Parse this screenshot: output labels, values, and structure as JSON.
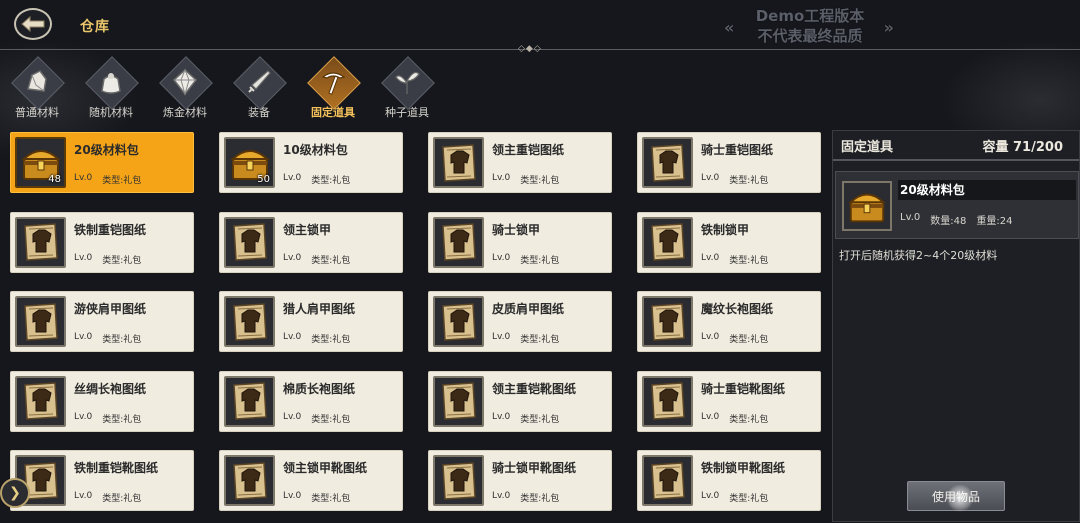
{
  "header": {
    "title": "仓库",
    "watermark_line1": "Demo工程版本",
    "watermark_line2": "不代表最终品质"
  },
  "tabs": [
    {
      "label": "普通材料",
      "icon": "ore-icon",
      "active": false
    },
    {
      "label": "随机材料",
      "icon": "bag-icon",
      "active": false
    },
    {
      "label": "炼金材料",
      "icon": "crystal-icon",
      "active": false
    },
    {
      "label": "装备",
      "icon": "sword-icon",
      "active": false
    },
    {
      "label": "固定道具",
      "icon": "pickaxe-icon",
      "active": true
    },
    {
      "label": "种子道具",
      "icon": "sprout-icon",
      "active": false
    }
  ],
  "items": [
    {
      "name": "20级材料包",
      "level": "Lv.0",
      "type": "类型:礼包",
      "qty": "48",
      "icon": "chest-icon",
      "selected": true
    },
    {
      "name": "10级材料包",
      "level": "Lv.0",
      "type": "类型:礼包",
      "qty": "50",
      "icon": "chest-icon",
      "selected": false
    },
    {
      "name": "领主重铠图纸",
      "level": "Lv.0",
      "type": "类型:礼包",
      "qty": "",
      "icon": "blueprint-icon",
      "selected": false
    },
    {
      "name": "骑士重铠图纸",
      "level": "Lv.0",
      "type": "类型:礼包",
      "qty": "",
      "icon": "blueprint-icon",
      "selected": false
    },
    {
      "name": "铁制重铠图纸",
      "level": "Lv.0",
      "type": "类型:礼包",
      "qty": "",
      "icon": "blueprint-icon",
      "selected": false
    },
    {
      "name": "领主锁甲",
      "level": "Lv.0",
      "type": "类型:礼包",
      "qty": "",
      "icon": "blueprint-icon",
      "selected": false
    },
    {
      "name": "骑士锁甲",
      "level": "Lv.0",
      "type": "类型:礼包",
      "qty": "",
      "icon": "blueprint-icon",
      "selected": false
    },
    {
      "name": "铁制锁甲",
      "level": "Lv.0",
      "type": "类型:礼包",
      "qty": "",
      "icon": "blueprint-icon",
      "selected": false
    },
    {
      "name": "游侠肩甲图纸",
      "level": "Lv.0",
      "type": "类型:礼包",
      "qty": "",
      "icon": "blueprint-icon",
      "selected": false
    },
    {
      "name": "猎人肩甲图纸",
      "level": "Lv.0",
      "type": "类型:礼包",
      "qty": "",
      "icon": "blueprint-icon",
      "selected": false
    },
    {
      "name": "皮质肩甲图纸",
      "level": "Lv.0",
      "type": "类型:礼包",
      "qty": "",
      "icon": "blueprint-icon",
      "selected": false
    },
    {
      "name": "魔纹长袍图纸",
      "level": "Lv.0",
      "type": "类型:礼包",
      "qty": "",
      "icon": "blueprint-icon",
      "selected": false
    },
    {
      "name": "丝绸长袍图纸",
      "level": "Lv.0",
      "type": "类型:礼包",
      "qty": "",
      "icon": "blueprint-icon",
      "selected": false
    },
    {
      "name": "棉质长袍图纸",
      "level": "Lv.0",
      "type": "类型:礼包",
      "qty": "",
      "icon": "blueprint-icon",
      "selected": false
    },
    {
      "name": "领主重铠靴图纸",
      "level": "Lv.0",
      "type": "类型:礼包",
      "qty": "",
      "icon": "blueprint-icon",
      "selected": false
    },
    {
      "name": "骑士重铠靴图纸",
      "level": "Lv.0",
      "type": "类型:礼包",
      "qty": "",
      "icon": "blueprint-icon",
      "selected": false
    },
    {
      "name": "铁制重铠靴图纸",
      "level": "Lv.0",
      "type": "类型:礼包",
      "qty": "",
      "icon": "blueprint-icon",
      "selected": false
    },
    {
      "name": "领主锁甲靴图纸",
      "level": "Lv.0",
      "type": "类型:礼包",
      "qty": "",
      "icon": "blueprint-icon",
      "selected": false
    },
    {
      "name": "骑士锁甲靴图纸",
      "level": "Lv.0",
      "type": "类型:礼包",
      "qty": "",
      "icon": "blueprint-icon",
      "selected": false
    },
    {
      "name": "铁制锁甲靴图纸",
      "level": "Lv.0",
      "type": "类型:礼包",
      "qty": "",
      "icon": "blueprint-icon",
      "selected": false
    }
  ],
  "panel": {
    "category": "固定道具",
    "capacity": "容量 71/200",
    "item_name": "20级材料包",
    "item_level": "Lv.0",
    "item_count": "数量:48",
    "item_weight": "重量:24",
    "description": "打开后随机获得2~4个20级材料",
    "use_button": "使用物品"
  },
  "colors": {
    "accent": "#f5a417",
    "title": "#e9c56a",
    "card_bg": "#f1ece0",
    "background": "#15171c"
  }
}
